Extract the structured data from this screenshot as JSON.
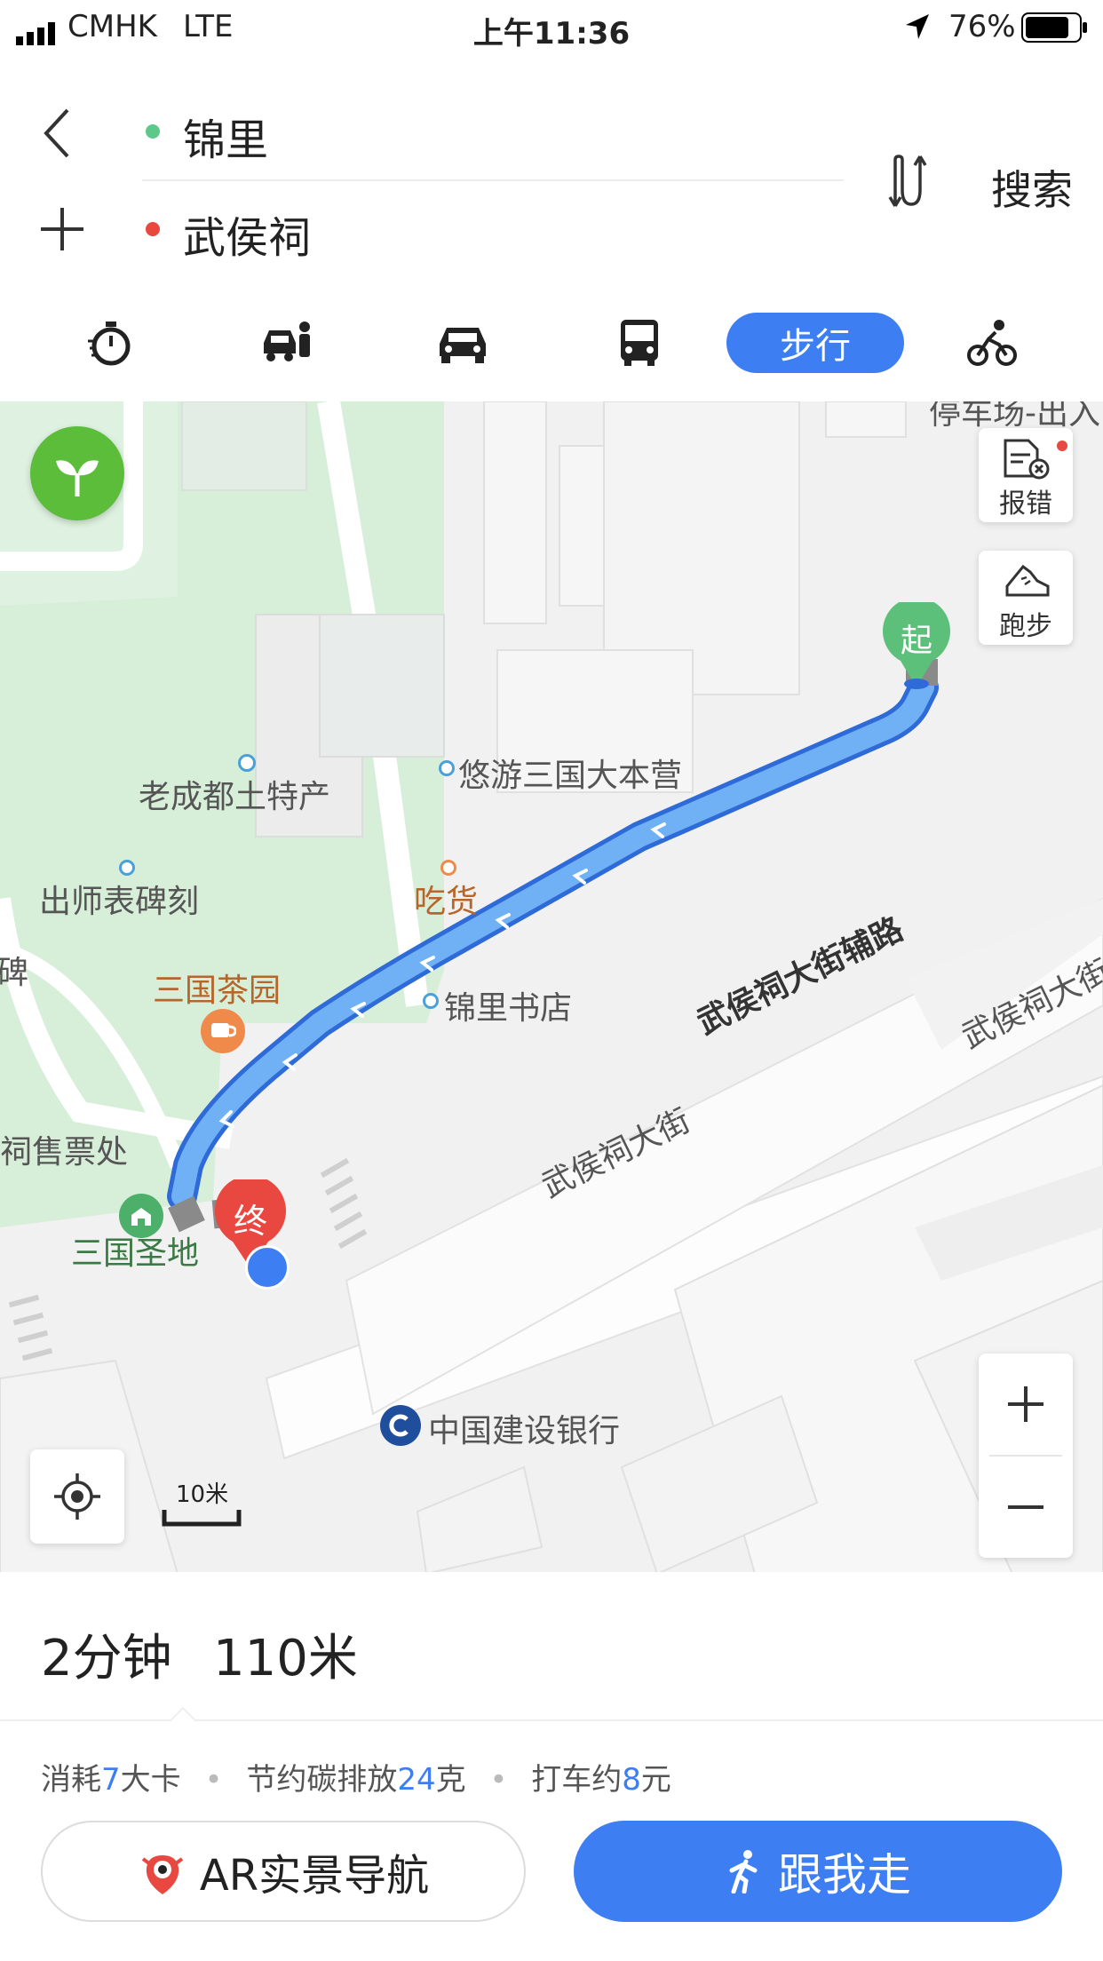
{
  "status_bar": {
    "carrier": "CMHK",
    "network": "LTE",
    "time": "上午11:36",
    "battery": "76%"
  },
  "route": {
    "origin": "锦里",
    "destination": "武侯祠",
    "search_label": "搜索"
  },
  "modes": {
    "active_label": "步行"
  },
  "map": {
    "labels": {
      "l1": "老成都土特产",
      "l2": "悠游三国大本营",
      "l3": "出师表碑刻",
      "l4": "吃货",
      "l5": "三国茶园",
      "l6": "锦里书店",
      "l7": "武侯祠大街辅路",
      "l8": "武侯祠大街",
      "l9": "武侯祠大街",
      "l10": "三国圣地",
      "l11": "中国建设银行",
      "l12": "停车场-出入口",
      "l13": "侯祠售票处",
      "l14": "明碑"
    },
    "start_marker": "起",
    "end_marker": "终",
    "report_error": "报错",
    "running": "跑步",
    "scale": "10米"
  },
  "summary": {
    "duration": "2分钟",
    "distance": "110米",
    "calories_prefix": "消耗",
    "calories_value": "7",
    "calories_unit": "大卡",
    "carbon_prefix": "节约碳排放",
    "carbon_value": "24",
    "carbon_unit": "克",
    "taxi_prefix": "打车约",
    "taxi_value": "8",
    "taxi_unit": "元"
  },
  "buttons": {
    "ar_nav": "AR实景导航",
    "follow": "跟我走"
  },
  "colors": {
    "accent": "#3d7ef2",
    "origin_dot": "#5cc98a",
    "dest_dot": "#e8483f"
  }
}
